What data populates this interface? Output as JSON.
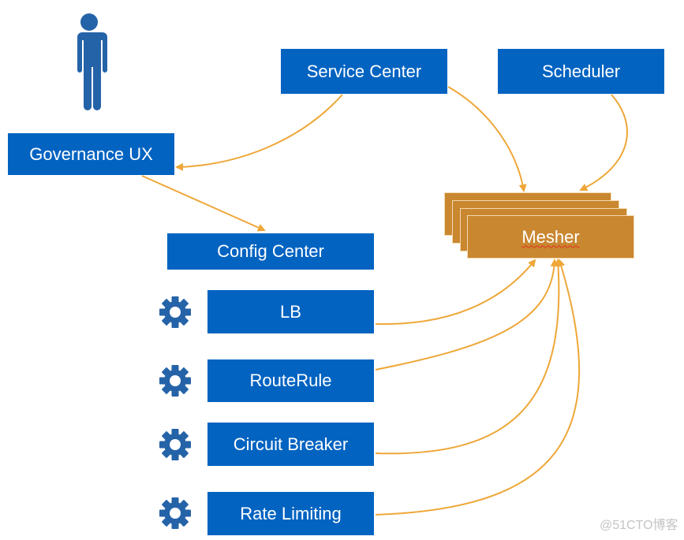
{
  "diagram": {
    "colors": {
      "box_fill": "#0263c1",
      "box_text": "#ffffff",
      "mesher_fill": "#c98730",
      "arrow": "#eea738",
      "icon": "#2563a8"
    },
    "user_icon": "person-icon",
    "nodes": {
      "governance_ux": "Governance UX",
      "service_center": "Service Center",
      "scheduler": "Scheduler",
      "config_center": "Config Center",
      "mesher": "Mesher",
      "lb": "LB",
      "route_rule": "RouteRule",
      "circuit_breaker": "Circuit Breaker",
      "rate_limiting": "Rate Limiting"
    },
    "policy_icon": "gear-icon",
    "edges": [
      {
        "from": "Service Center",
        "to": "Governance UX"
      },
      {
        "from": "Governance UX",
        "to": "Config Center"
      },
      {
        "from": "Service Center",
        "to": "Mesher"
      },
      {
        "from": "Scheduler",
        "to": "Mesher"
      },
      {
        "from": "LB",
        "to": "Mesher"
      },
      {
        "from": "RouteRule",
        "to": "Mesher"
      },
      {
        "from": "Circuit Breaker",
        "to": "Mesher"
      },
      {
        "from": "Rate Limiting",
        "to": "Mesher"
      }
    ]
  },
  "watermark": "@51CTO博客"
}
